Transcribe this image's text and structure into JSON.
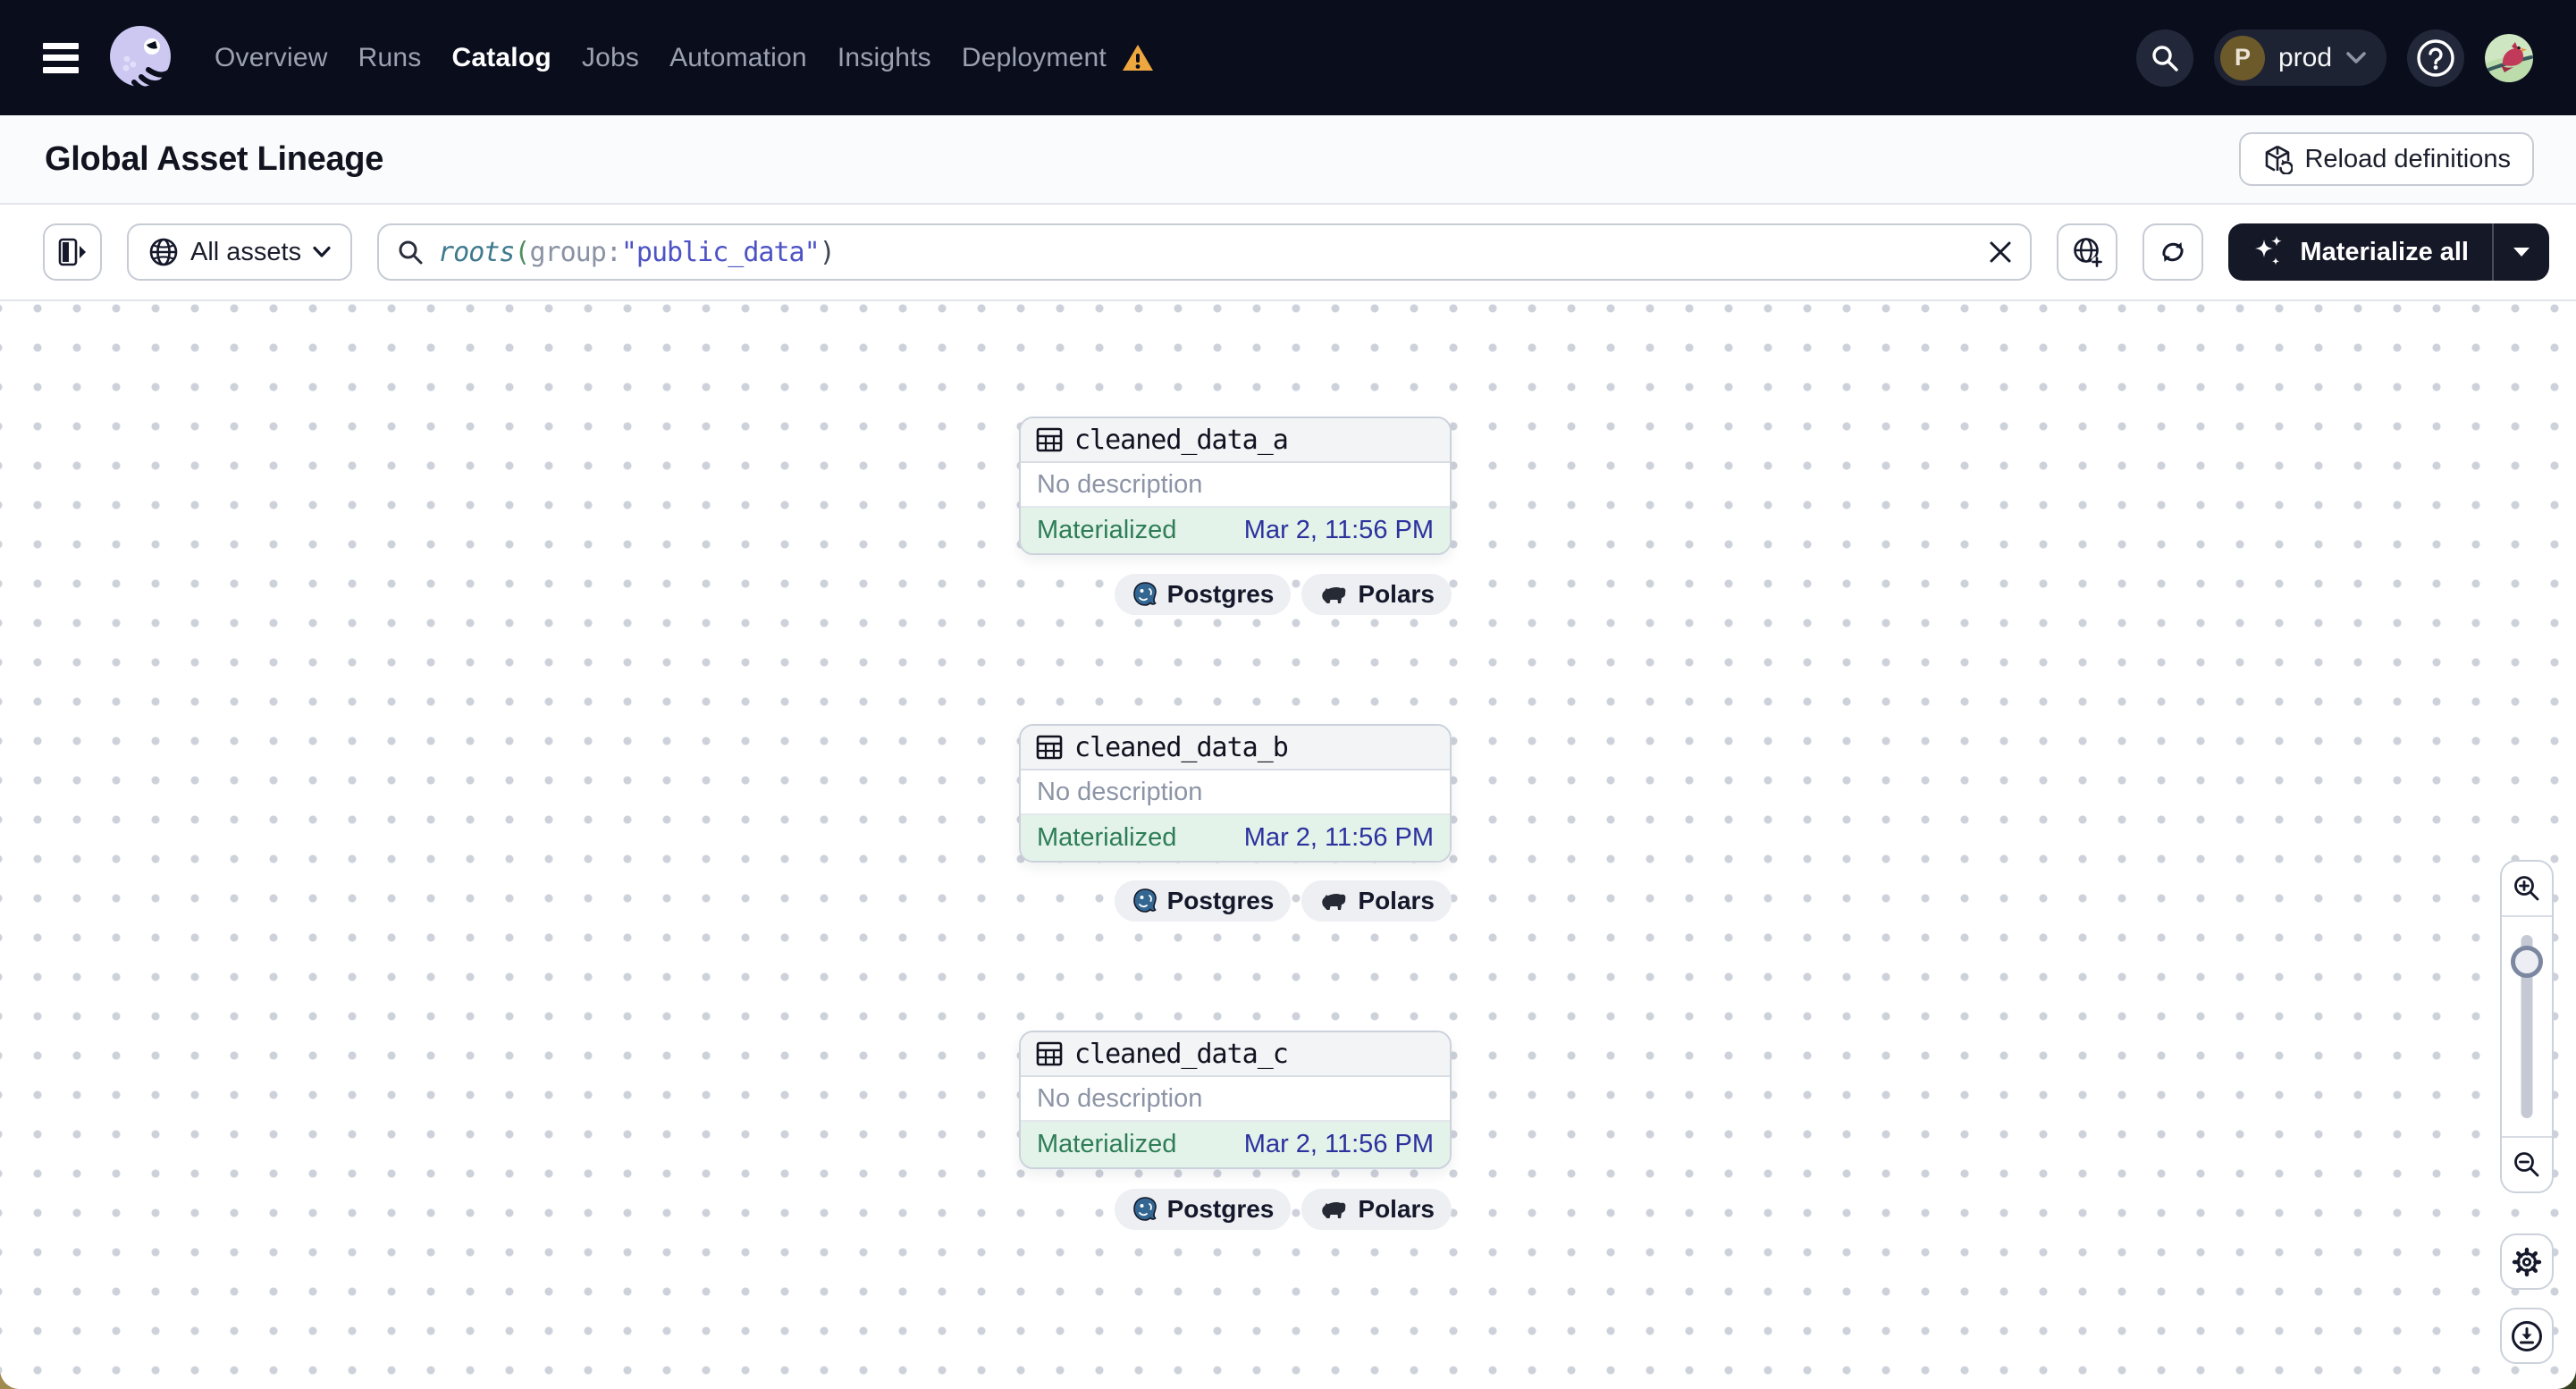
{
  "nav": {
    "items": [
      {
        "label": "Overview",
        "active": false
      },
      {
        "label": "Runs",
        "active": false
      },
      {
        "label": "Catalog",
        "active": true
      },
      {
        "label": "Jobs",
        "active": false
      },
      {
        "label": "Automation",
        "active": false
      },
      {
        "label": "Insights",
        "active": false
      },
      {
        "label": "Deployment",
        "active": false,
        "warning": true
      }
    ],
    "deployment_switcher": {
      "initial": "P",
      "label": "prod"
    }
  },
  "header": {
    "title": "Global Asset Lineage",
    "reload_label": "Reload definitions"
  },
  "toolbar": {
    "scope_label": "All assets",
    "query": {
      "fn": "roots",
      "open_paren": "(",
      "key": "group:",
      "value": "\"public_data\"",
      "close_paren": ")"
    },
    "materialize_label": "Materialize all"
  },
  "graph": {
    "nodes": [
      {
        "name": "cleaned_data_a",
        "description": "No description",
        "status": "Materialized",
        "last_materialized": "Mar 2, 11:56 PM",
        "tags": [
          {
            "label": "Postgres"
          },
          {
            "label": "Polars"
          }
        ]
      },
      {
        "name": "cleaned_data_b",
        "description": "No description",
        "status": "Materialized",
        "last_materialized": "Mar 2, 11:56 PM",
        "tags": [
          {
            "label": "Postgres"
          },
          {
            "label": "Polars"
          }
        ]
      },
      {
        "name": "cleaned_data_c",
        "description": "No description",
        "status": "Materialized",
        "last_materialized": "Mar 2, 11:56 PM",
        "tags": [
          {
            "label": "Postgres"
          },
          {
            "label": "Polars"
          }
        ]
      }
    ]
  },
  "colors": {
    "nav_bg": "#0a0d1c",
    "status_green_text": "#2e7d56",
    "status_green_bg": "#e3f3e9",
    "timestamp_blue": "#2c319e",
    "warning_amber": "#eda73e",
    "materialize_bg": "#151827"
  }
}
